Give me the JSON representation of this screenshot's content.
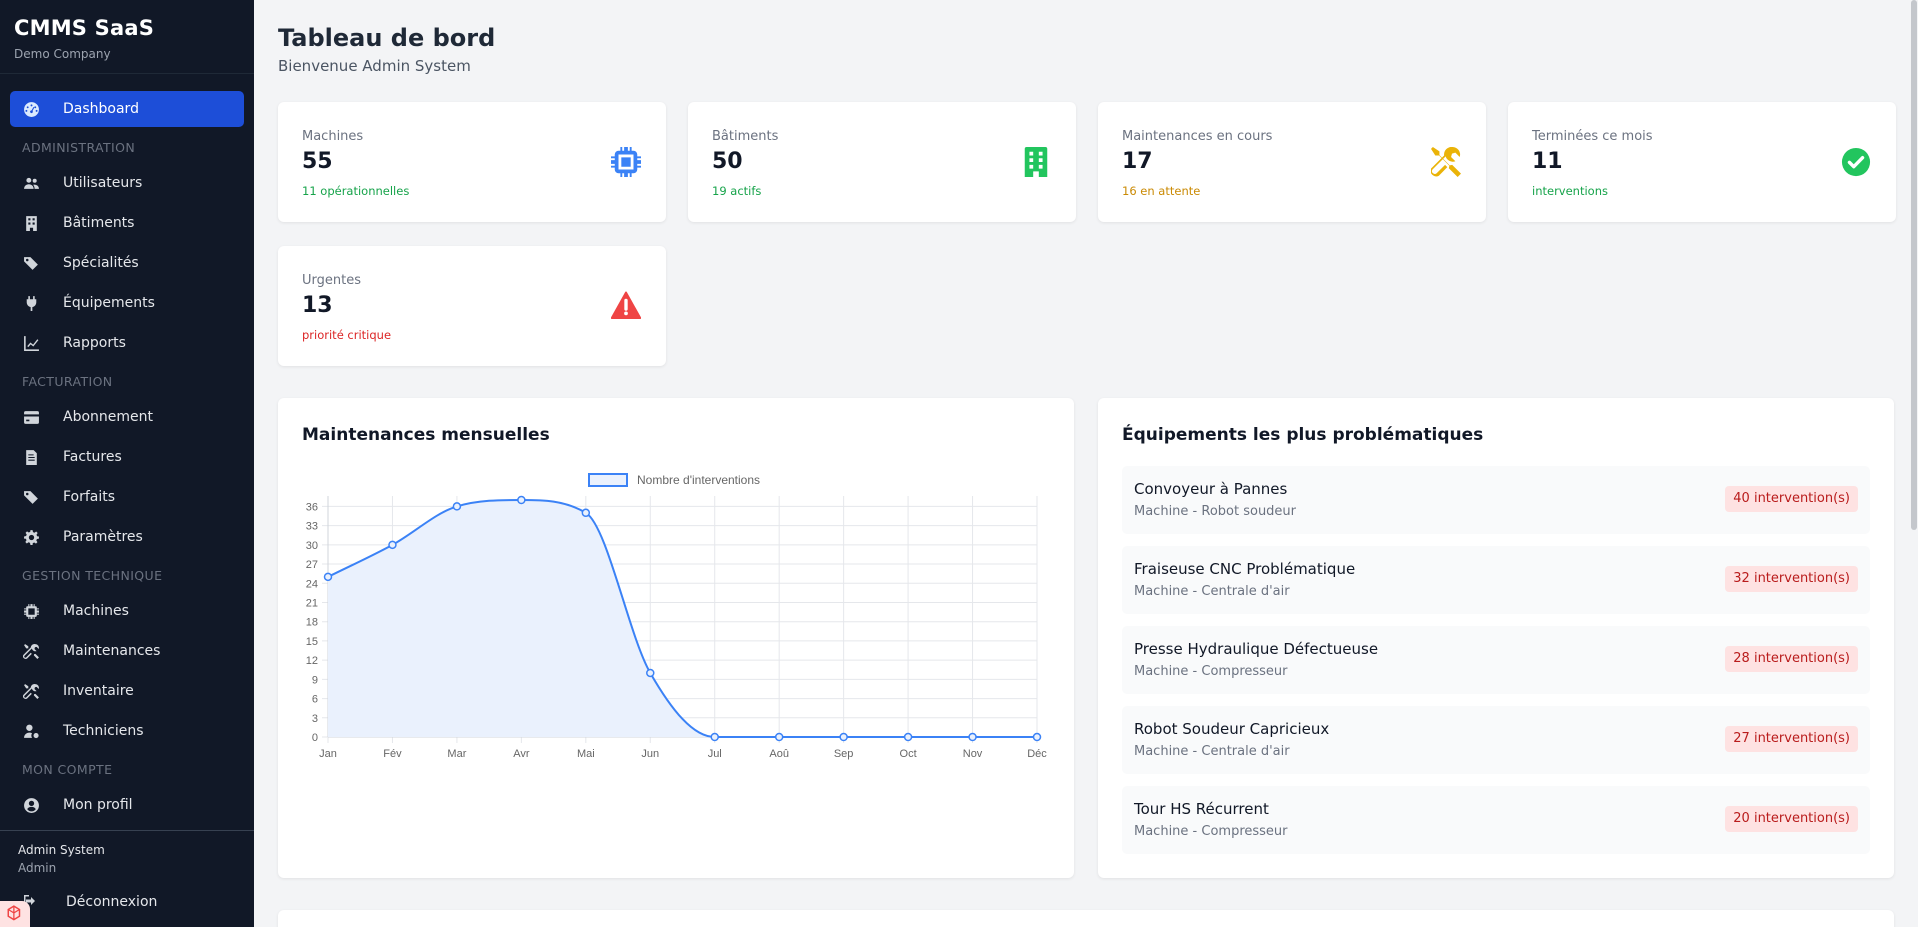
{
  "sidebar": {
    "brand_title": "CMMS SaaS",
    "brand_sub": "Demo Company",
    "dashboard": "Dashboard",
    "sections": {
      "administration": "ADMINISTRATION",
      "facturation": "FACTURATION",
      "gestion": "GESTION TECHNIQUE",
      "compte": "MON COMPTE"
    },
    "admin_items": [
      "Utilisateurs",
      "Bâtiments",
      "Spécialités",
      "Équipements",
      "Rapports"
    ],
    "billing_items": [
      "Abonnement",
      "Factures",
      "Forfaits",
      "Paramètres"
    ],
    "tech_items": [
      "Machines",
      "Maintenances",
      "Inventaire",
      "Techniciens"
    ],
    "account_items": [
      "Mon profil"
    ],
    "user_name": "Admin System",
    "user_role": "Admin",
    "logout": "Déconnexion"
  },
  "header": {
    "title": "Tableau de bord",
    "subtitle": "Bienvenue Admin System"
  },
  "stats": [
    {
      "label": "Machines",
      "value": "55",
      "note": "11 opérationnelles",
      "note_color": "#16a34a",
      "icon": "chip-icon",
      "icon_color": "#3b82f6"
    },
    {
      "label": "Bâtiments",
      "value": "50",
      "note": "19 actifs",
      "note_color": "#16a34a",
      "icon": "building-icon",
      "icon_color": "#22c55e"
    },
    {
      "label": "Maintenances en cours",
      "value": "17",
      "note": "16 en attente",
      "note_color": "#ca8a04",
      "icon": "tools-icon",
      "icon_color": "#eab308"
    },
    {
      "label": "Terminées ce mois",
      "value": "11",
      "note": "interventions",
      "note_color": "#16a34a",
      "icon": "check-circle-icon",
      "icon_color": "#22c55e"
    },
    {
      "label": "Urgentes",
      "value": "13",
      "note": "priorité critique",
      "note_color": "#dc2626",
      "icon": "warning-icon",
      "icon_color": "#ef4444"
    }
  ],
  "chart_panel": {
    "title": "Maintenances mensuelles"
  },
  "chart_data": {
    "type": "line",
    "categories": [
      "Jan",
      "Fév",
      "Mar",
      "Avr",
      "Mai",
      "Jun",
      "Jul",
      "Aoû",
      "Sep",
      "Oct",
      "Nov",
      "Déc"
    ],
    "series": [
      {
        "name": "Nombre d'interventions",
        "values": [
          25,
          30,
          36,
          37,
          35,
          10,
          0,
          0,
          0,
          0,
          0,
          0
        ],
        "color": "#3b82f6",
        "fill": "#eaf1fd"
      }
    ],
    "yticks": [
      "0",
      "3",
      "6",
      "9",
      "12",
      "15",
      "18",
      "21",
      "24",
      "27",
      "30",
      "33",
      "36"
    ],
    "ylim": [
      0,
      37
    ],
    "grid": true,
    "legend": "top-center",
    "title": "",
    "xlabel": "",
    "ylabel": ""
  },
  "problems_panel": {
    "title": "Équipements les plus problématiques",
    "items": [
      {
        "name": "Convoyeur à Pannes",
        "sub": "Machine - Robot soudeur",
        "badge": "40 intervention(s)"
      },
      {
        "name": "Fraiseuse CNC Problématique",
        "sub": "Machine - Centrale d'air",
        "badge": "32 intervention(s)"
      },
      {
        "name": "Presse Hydraulique Défectueuse",
        "sub": "Machine - Compresseur",
        "badge": "28 intervention(s)"
      },
      {
        "name": "Robot Soudeur Capricieux",
        "sub": "Machine - Centrale d'air",
        "badge": "27 intervention(s)"
      },
      {
        "name": "Tour HS Récurrent",
        "sub": "Machine - Compresseur",
        "badge": "20 intervention(s)"
      }
    ]
  }
}
